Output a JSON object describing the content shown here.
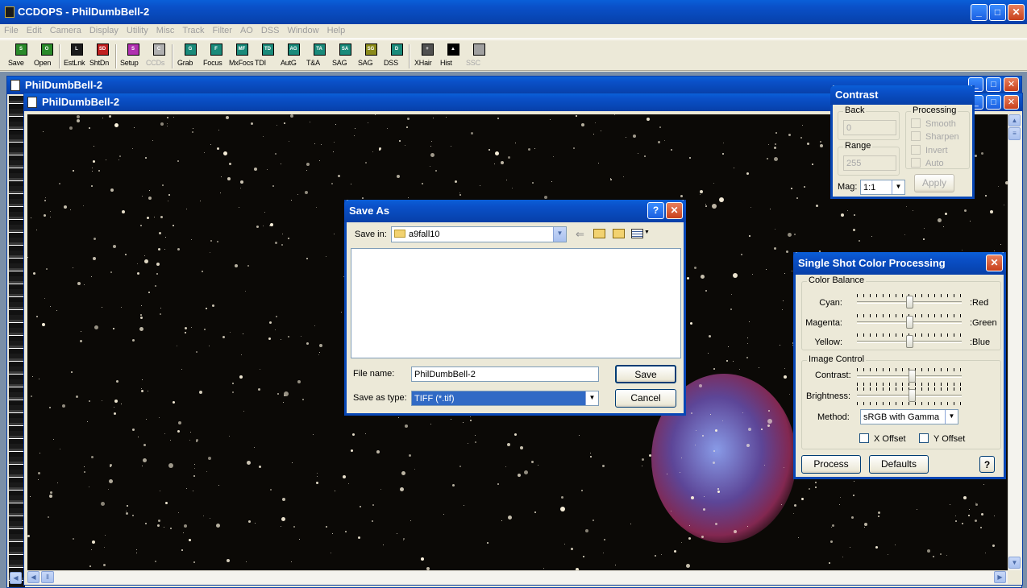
{
  "app": {
    "title": "CCDOPS - PhilDumbBell-2"
  },
  "menu": [
    "File",
    "Edit",
    "Camera",
    "Display",
    "Utility",
    "Misc",
    "Track",
    "Filter",
    "AO",
    "DSS",
    "Window",
    "Help"
  ],
  "toolbar": [
    {
      "label": "Save",
      "code": "S",
      "color": "#2a8a2a",
      "disabled": false
    },
    {
      "label": "Open",
      "code": "O",
      "color": "#2a8a2a",
      "disabled": false
    },
    {
      "label": "EstLnk",
      "code": "L",
      "color": "#1a1a1a",
      "disabled": false
    },
    {
      "label": "ShtDn",
      "code": "SD",
      "color": "#c02020",
      "disabled": false
    },
    {
      "label": "Setup",
      "code": "S",
      "color": "#b030b0",
      "disabled": false
    },
    {
      "label": "CCDs",
      "code": "C",
      "color": "#b0b0b0",
      "disabled": true
    },
    {
      "label": "Grab",
      "code": "G",
      "color": "#1a8a7a",
      "disabled": false
    },
    {
      "label": "Focus",
      "code": "F",
      "color": "#1a8a7a",
      "disabled": false
    },
    {
      "label": "MxFocs",
      "code": "MF",
      "color": "#1a8a7a",
      "disabled": false
    },
    {
      "label": "TDI",
      "code": "TD",
      "color": "#1a8a7a",
      "disabled": false
    },
    {
      "label": "AutG",
      "code": "AG",
      "color": "#1a8a7a",
      "disabled": false
    },
    {
      "label": "T&A",
      "code": "TA",
      "color": "#1a8a7a",
      "disabled": false
    },
    {
      "label": "SAG",
      "code": "SA",
      "color": "#1a8a7a",
      "disabled": false
    },
    {
      "label": "SAG",
      "code": "SG",
      "color": "#8a8a1a",
      "disabled": false
    },
    {
      "label": "DSS",
      "code": "D",
      "color": "#1a8a7a",
      "disabled": false
    },
    {
      "label": "XHair",
      "code": "+",
      "color": "#505050",
      "disabled": false
    },
    {
      "label": "Hist",
      "code": "▲",
      "color": "#000000",
      "disabled": false
    },
    {
      "label": "SSC",
      "code": "",
      "color": "#a0a0a0",
      "disabled": true
    }
  ],
  "child_back": {
    "title": "PhilDumbBell-2"
  },
  "child_front": {
    "title": "PhilDumbBell-2"
  },
  "save_dialog": {
    "title": "Save As",
    "save_in_label": "Save in:",
    "save_in_value": "a9fall10",
    "file_name_label": "File name:",
    "file_name_value": "PhilDumbBell-2",
    "save_type_label": "Save as type:",
    "save_type_value": "TIFF (*.tif)",
    "save_button": "Save",
    "cancel_button": "Cancel",
    "help_glyph": "?",
    "close_glyph": "✕"
  },
  "contrast": {
    "title": "Contrast",
    "back_label": "Back",
    "back_value": "0",
    "range_label": "Range",
    "range_value": "255",
    "processing_label": "Processing",
    "options": [
      "Smooth",
      "Sharpen",
      "Invert",
      "Auto"
    ],
    "mag_label": "Mag:",
    "mag_value": "1:1",
    "apply_button": "Apply"
  },
  "ssc": {
    "title": "Single Shot Color Processing",
    "color_balance_label": "Color Balance",
    "balance": [
      {
        "left": "Cyan:",
        "right": ":Red",
        "value": 0.5
      },
      {
        "left": "Magenta:",
        "right": ":Green",
        "value": 0.5
      },
      {
        "left": "Yellow:",
        "right": ":Blue",
        "value": 0.5
      }
    ],
    "image_control_label": "Image Control",
    "contrast_label": "Contrast:",
    "contrast_value": 0.53,
    "brightness_label": "Brightness:",
    "brightness_value": 0.53,
    "method_label": "Method:",
    "method_value": "sRGB with Gamma",
    "x_offset": "X Offset",
    "y_offset": "Y Offset",
    "process_button": "Process",
    "defaults_button": "Defaults",
    "help_glyph": "?"
  }
}
